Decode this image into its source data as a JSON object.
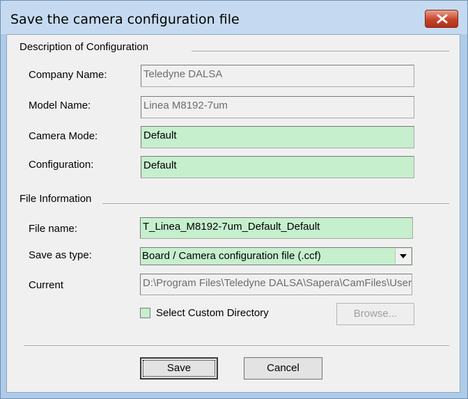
{
  "window": {
    "title": "Save the camera configuration file"
  },
  "description_group": {
    "label": "Description of Configuration",
    "company_label": "Company Name:",
    "company_value": "Teledyne DALSA",
    "model_label": "Model Name:",
    "model_value": "Linea M8192-7um",
    "camera_mode_label": "Camera Mode:",
    "camera_mode_value": "Default",
    "configuration_label": "Configuration:",
    "configuration_value": "Default"
  },
  "file_group": {
    "label": "File Information",
    "file_name_label": "File name:",
    "file_name_value": "T_Linea_M8192-7um_Default_Default",
    "save_type_label": "Save as type:",
    "save_type_value": "Board / Camera configuration file (.ccf)",
    "current_label": "Current",
    "current_value": "D:\\Program Files\\Teledyne DALSA\\Sapera\\CamFiles\\User",
    "custom_dir_label": "Select Custom Directory",
    "custom_dir_checked": false,
    "browse_label": "Browse..."
  },
  "buttons": {
    "save_label": "Save",
    "cancel_label": "Cancel"
  },
  "colors": {
    "editable_field": "#c6efce",
    "close_button": "#c7432a",
    "title_bar": "#c5daf0"
  }
}
